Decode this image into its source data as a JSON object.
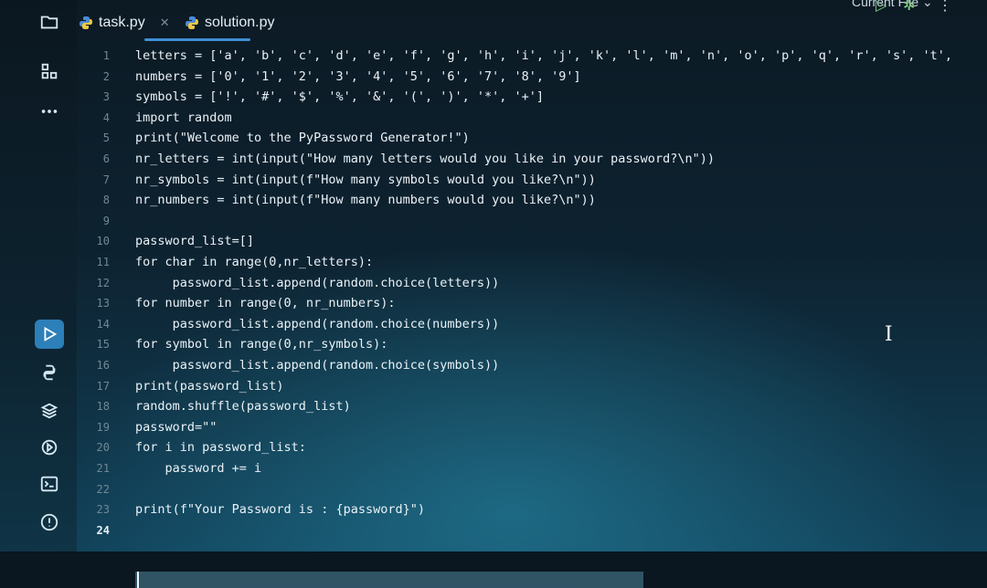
{
  "tabs": [
    {
      "label": "task.py",
      "active": true
    },
    {
      "label": "solution.py",
      "active": false
    }
  ],
  "run_config_label": "Current File",
  "colors": {
    "accent": "#3f8fd4",
    "run": "#2c7fb8"
  },
  "activity_icons": [
    "folder-icon",
    "structure-icon",
    "more-icon",
    "run-icon",
    "python-icon",
    "layers-icon",
    "services-icon",
    "terminal-icon",
    "problems-icon"
  ],
  "editor": {
    "lines": [
      {
        "n": "1",
        "code": "letters = ['a', 'b', 'c', 'd', 'e', 'f', 'g', 'h', 'i', 'j', 'k', 'l', 'm', 'n', 'o', 'p', 'q', 'r', 's', 't',"
      },
      {
        "n": "2",
        "code": "numbers = ['0', '1', '2', '3', '4', '5', '6', '7', '8', '9']"
      },
      {
        "n": "3",
        "code": "symbols = ['!', '#', '$', '%', '&', '(', ')', '*', '+']"
      },
      {
        "n": "4",
        "code": "import random"
      },
      {
        "n": "5",
        "code": "print(\"Welcome to the PyPassword Generator!\")"
      },
      {
        "n": "6",
        "code": "nr_letters = int(input(\"How many letters would you like in your password?\\n\"))"
      },
      {
        "n": "7",
        "code": "nr_symbols = int(input(f\"How many symbols would you like?\\n\"))"
      },
      {
        "n": "8",
        "code": "nr_numbers = int(input(f\"How many numbers would you like?\\n\"))"
      },
      {
        "n": "9",
        "code": ""
      },
      {
        "n": "10",
        "code": "password_list=[]"
      },
      {
        "n": "11",
        "code": "for char in range(0,nr_letters):"
      },
      {
        "n": "12",
        "code": "     password_list.append(random.choice(letters))"
      },
      {
        "n": "13",
        "code": "for number in range(0, nr_numbers):"
      },
      {
        "n": "14",
        "code": "     password_list.append(random.choice(numbers))"
      },
      {
        "n": "15",
        "code": "for symbol in range(0,nr_symbols):"
      },
      {
        "n": "16",
        "code": "     password_list.append(random.choice(symbols))"
      },
      {
        "n": "17",
        "code": "print(password_list)"
      },
      {
        "n": "18",
        "code": "random.shuffle(password_list)"
      },
      {
        "n": "19",
        "code": "password=\"\""
      },
      {
        "n": "20",
        "code": "for i in password_list:"
      },
      {
        "n": "21",
        "code": "    password += i"
      },
      {
        "n": "22",
        "code": ""
      },
      {
        "n": "23",
        "code": "print(f\"Your Password is : {password}\")"
      },
      {
        "n": "24",
        "code": ""
      }
    ],
    "current_line": "24"
  }
}
